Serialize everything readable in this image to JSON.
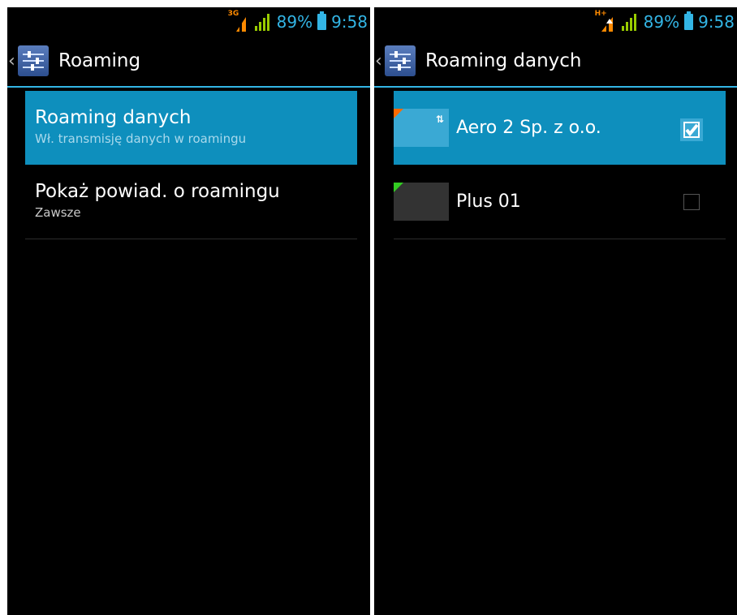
{
  "left": {
    "status": {
      "network_type": "3G",
      "battery": "89%",
      "time": "9:58"
    },
    "title": "Roaming",
    "items": [
      {
        "title": "Roaming danych",
        "summary": "Wł. transmisję danych w roamingu"
      },
      {
        "title": "Pokaż powiad. o roamingu",
        "summary": "Zawsze"
      }
    ]
  },
  "right": {
    "status": {
      "network_type": "H+",
      "battery": "89%",
      "time": "9:58"
    },
    "title": "Roaming danych",
    "operators": [
      {
        "name": "Aero 2 Sp. z o.o.",
        "checked": true,
        "corner_color": "#ff6a00"
      },
      {
        "name": "Plus 01",
        "checked": false,
        "corner_color": "#33cc22"
      }
    ]
  },
  "icons": {
    "signal": "signal-icon",
    "battery": "battery-icon",
    "settings": "settings-sliders-icon",
    "data_transfer": "data-transfer-arrows-icon",
    "check": "checkmark-icon"
  },
  "colors": {
    "accent": "#33b5e5",
    "selected": "#0e8fbd",
    "signal": "#99cc00"
  }
}
